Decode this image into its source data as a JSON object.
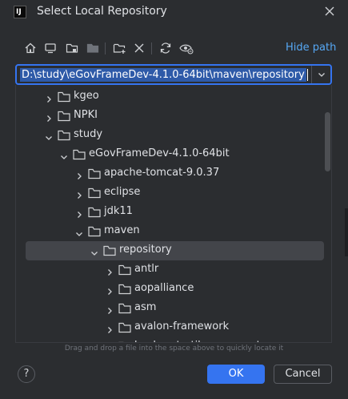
{
  "window": {
    "logo_text": "IJ",
    "title": "Select Local Repository"
  },
  "toolbar": {
    "hide_path_label": "Hide path",
    "icons": [
      "home-icon",
      "desktop-icon",
      "project-folder-icon",
      "module-folder-icon",
      "new-folder-icon",
      "delete-icon",
      "refresh-icon",
      "show-hidden-icon"
    ]
  },
  "path": {
    "value": "D:\\study\\eGovFrameDev-4.1.0-64bit\\maven\\repository"
  },
  "tree": {
    "rows": [
      {
        "label": "kgeo",
        "depth": 0,
        "expanded": false
      },
      {
        "label": "NPKI",
        "depth": 0,
        "expanded": false
      },
      {
        "label": "study",
        "depth": 0,
        "expanded": true
      },
      {
        "label": "eGovFrameDev-4.1.0-64bit",
        "depth": 1,
        "expanded": true
      },
      {
        "label": "apache-tomcat-9.0.37",
        "depth": 2,
        "expanded": false
      },
      {
        "label": "eclipse",
        "depth": 2,
        "expanded": false
      },
      {
        "label": "jdk11",
        "depth": 2,
        "expanded": false
      },
      {
        "label": "maven",
        "depth": 2,
        "expanded": true
      },
      {
        "label": "repository",
        "depth": 3,
        "expanded": true,
        "selected": true
      },
      {
        "label": "antlr",
        "depth": 4,
        "expanded": false
      },
      {
        "label": "aopalliance",
        "depth": 4,
        "expanded": false
      },
      {
        "label": "asm",
        "depth": 4,
        "expanded": false
      },
      {
        "label": "avalon-framework",
        "depth": 4,
        "expanded": false
      },
      {
        "label": "backport-util-concurrent",
        "depth": 4,
        "expanded": false
      }
    ]
  },
  "hint": "Drag and drop a file into the space above to quickly locate it",
  "buttons": {
    "help": "?",
    "ok": "OK",
    "cancel": "Cancel"
  },
  "colors": {
    "background": "#2b2d30",
    "accent": "#3574f0",
    "link": "#56a8f5",
    "selection": "#43454a"
  }
}
